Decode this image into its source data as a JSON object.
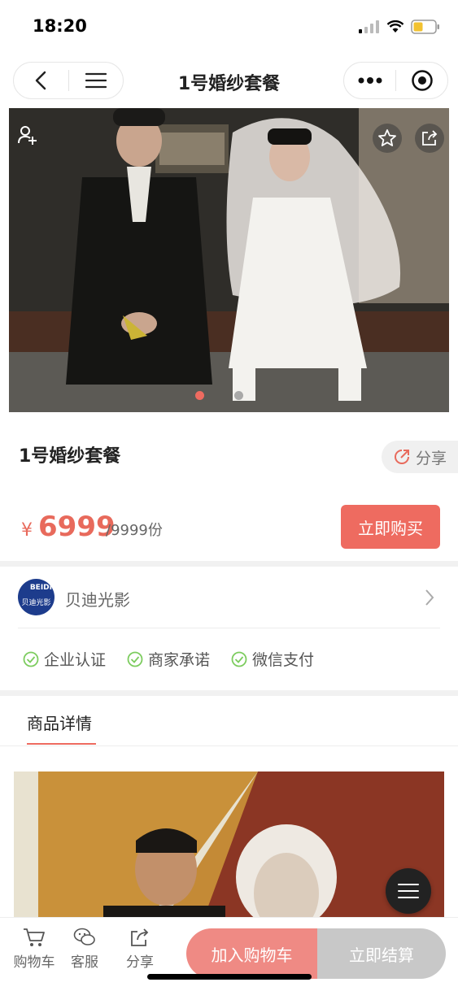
{
  "status_bar": {
    "time": "18:20"
  },
  "nav": {
    "title": "1号婚纱套餐"
  },
  "product": {
    "title": "1号婚纱套餐",
    "share_label": "分享",
    "currency": "¥",
    "price": "6999",
    "stock": "/9999份",
    "buy_now_label": "立即购买",
    "carousel_active_index": 0,
    "carousel_count": 2
  },
  "shop": {
    "logo_text_top": "BEIDI",
    "logo_text_bottom": "贝迪光影",
    "name": "贝迪光影",
    "badges": [
      "企业认证",
      "商家承诺",
      "微信支付"
    ]
  },
  "tabs": {
    "detail_label": "商品详情"
  },
  "bottom_bar": {
    "cart_label": "购物车",
    "service_label": "客服",
    "share_label": "分享",
    "add_to_cart_label": "加入购物车",
    "checkout_label": "立即结算"
  },
  "colors": {
    "accent": "#ee6b60",
    "price": "#e86a5c",
    "check_green": "#7ccc5e",
    "shop_logo": "#1d3c8c"
  }
}
